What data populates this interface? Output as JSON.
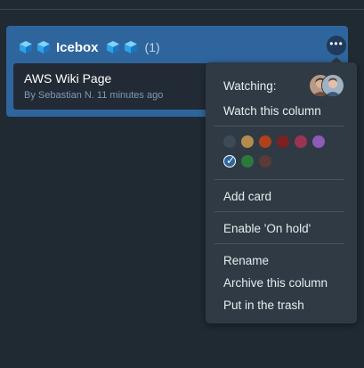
{
  "column": {
    "title": "Icebox",
    "count": "(1)",
    "color": "#2f659d",
    "more_icon": "more-horizontal-icon",
    "cube_icon": "cube-icon"
  },
  "card": {
    "title": "AWS Wiki Page",
    "meta": "By Sebastian N. 11 minutes ago"
  },
  "menu": {
    "watching_label": "Watching:",
    "watch_column": "Watch this column",
    "colors": [
      {
        "hex": "#3e4b56",
        "selected": false
      },
      {
        "hex": "#b38b4f",
        "selected": false
      },
      {
        "hex": "#b0401b",
        "selected": false
      },
      {
        "hex": "#7c2021",
        "selected": false
      },
      {
        "hex": "#9b3453",
        "selected": false
      },
      {
        "hex": "#8e5ab8",
        "selected": false
      },
      {
        "hex": "#2f659d",
        "selected": true
      },
      {
        "hex": "#2b7a3b",
        "selected": false
      },
      {
        "hex": "#5a3b37",
        "selected": false
      }
    ],
    "add_card": "Add card",
    "enable_on_hold": "Enable 'On hold'",
    "rename": "Rename",
    "archive_column": "Archive this column",
    "put_in_trash": "Put in the trash"
  }
}
